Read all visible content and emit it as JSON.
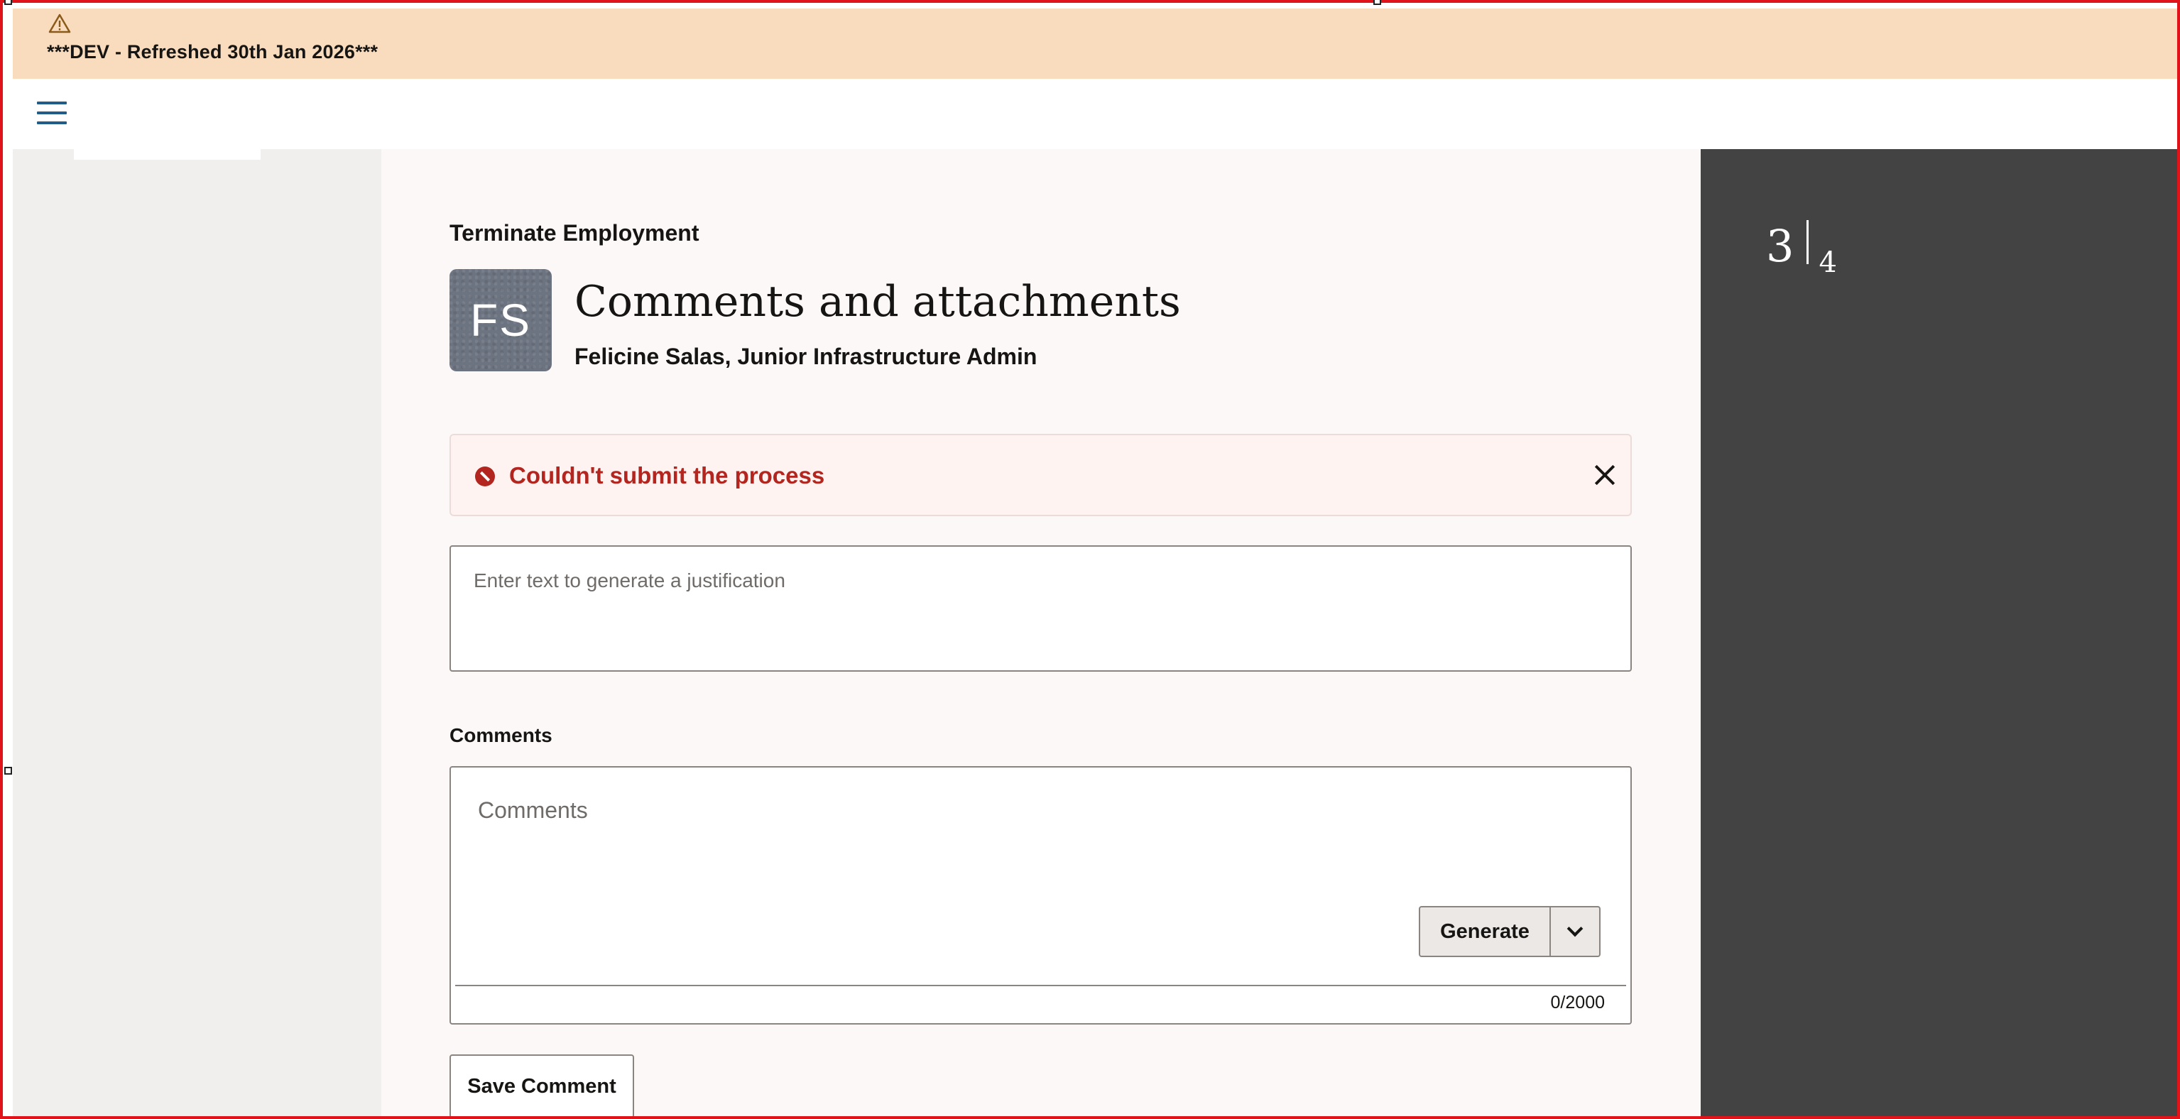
{
  "dev_banner": {
    "icon": "warning-icon",
    "text": "***DEV - Refreshed 30th Jan 2026***"
  },
  "header": {
    "menu_icon": "hamburger-icon"
  },
  "main": {
    "process_title": "Terminate Employment",
    "avatar_initials": "FS",
    "page_heading": "Comments and attachments",
    "person_subtitle": "Felicine Salas, Junior Infrastructure Admin",
    "error": {
      "icon": "error-circle-icon",
      "message": "Couldn't submit the process",
      "close_icon": "close-icon"
    },
    "justification": {
      "placeholder": "Enter text to generate a justification"
    },
    "comments": {
      "label": "Comments",
      "placeholder": "Comments",
      "generate_label": "Generate",
      "generate_menu_icon": "chevron-down-icon",
      "char_count": "0/2000"
    },
    "save_label": "Save Comment"
  },
  "progress": {
    "current": "3",
    "total": "4"
  },
  "colors": {
    "banner_bg": "#f9dcbd",
    "error_red": "#b3251f",
    "right_panel_bg": "#434343",
    "hamburger_blue": "#225d8a"
  }
}
